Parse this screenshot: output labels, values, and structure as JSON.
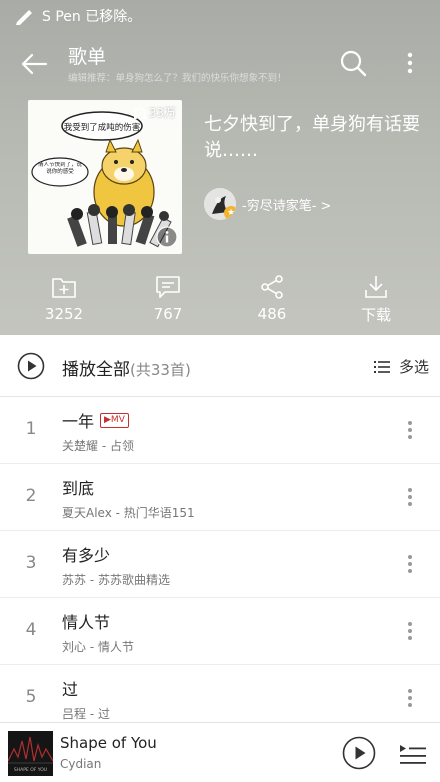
{
  "status_bar": {
    "notification": "S Pen 已移除。"
  },
  "titlebar": {
    "title": "歌单",
    "subtitle": "编辑推荐：单身狗怎么了？我们的快乐你想象不到！"
  },
  "playlist": {
    "name": "七夕快到了，单身狗有话要说……",
    "play_count": "33万",
    "cover_bubble_1": "我受到了成吨的伤害",
    "cover_bubble_2": "情人节快到了，说说你的感受",
    "creator": "-穷尽诗家笔- >"
  },
  "stats": {
    "collect": "3252",
    "comment": "767",
    "share": "486",
    "download": "下载"
  },
  "play_all": {
    "label": "播放全部",
    "count": "(共33首)",
    "multi_select": "多选"
  },
  "tracks": [
    {
      "num": "1",
      "title": "一年",
      "mv": "▶MV",
      "sub": "关楚耀 - 占领"
    },
    {
      "num": "2",
      "title": "到底",
      "sub": "夏天Alex - 热门华语151"
    },
    {
      "num": "3",
      "title": "有多少",
      "sub": "苏苏 - 苏苏歌曲精选"
    },
    {
      "num": "4",
      "title": "情人节",
      "sub": "刘心 - 情人节"
    },
    {
      "num": "5",
      "title": "过",
      "sub": "吕程 - 过"
    }
  ],
  "now_playing": {
    "title": "Shape of You",
    "artist": "Cydian",
    "cover_label": "SHAPE OF YOU"
  },
  "colors": {
    "accent": "#c62f2f",
    "header_bg": "#b2b4ae",
    "badge_star": "#f3b52e"
  },
  "icons": [
    "pen-icon",
    "back-arrow-icon",
    "search-icon",
    "more-vertical-icon",
    "headphone-icon",
    "info-icon",
    "folder-plus-icon",
    "comment-icon",
    "share-icon",
    "download-icon",
    "play-circle-icon",
    "list-icon",
    "kebab-icon",
    "playlist-icon"
  ]
}
